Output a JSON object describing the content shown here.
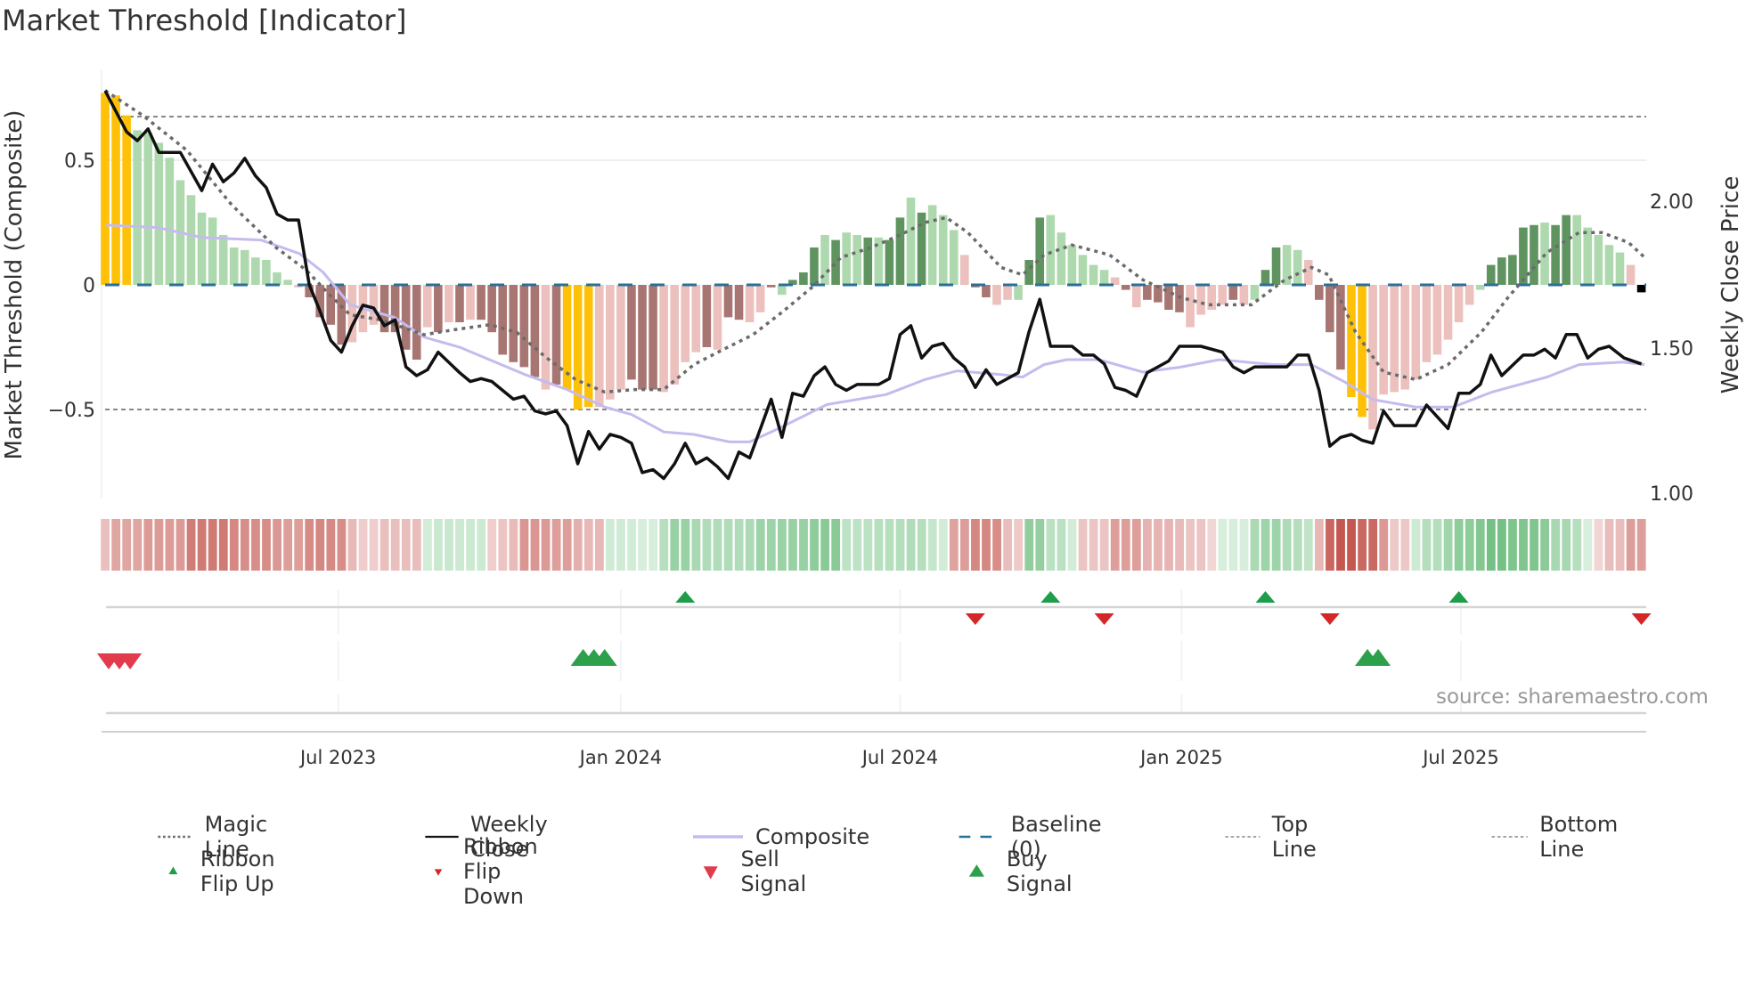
{
  "title": "Market Threshold [Indicator]",
  "source": "source: sharemaestro.com",
  "chart_data": {
    "type": "bar+line",
    "title": "Market Threshold [Indicator]",
    "ylabel_left": "Market Threshold (Composite)",
    "ylabel_right": "Weekly Close Price",
    "ylim_left": [
      -0.85,
      0.85
    ],
    "ylim_right": [
      1.0,
      2.3
    ],
    "left_ticks": [
      {
        "v": 0.5,
        "label": "0.5"
      },
      {
        "v": 0,
        "label": "0"
      },
      {
        "v": -0.5,
        "label": "−0.5"
      }
    ],
    "right_ticks": [
      {
        "v": 2.0,
        "label": "2.00"
      },
      {
        "v": 1.5,
        "label": "1.50"
      },
      {
        "v": 1.0,
        "label": "1.00"
      }
    ],
    "x_unit": "week index (0 = first week, Feb 2023)",
    "x_ticks": [
      {
        "x": 21.7,
        "label": "Jul 2023"
      },
      {
        "x": 48,
        "label": "Jan 2024"
      },
      {
        "x": 74,
        "label": "Jul 2024"
      },
      {
        "x": 100.2,
        "label": "Jan 2025"
      },
      {
        "x": 126.2,
        "label": "Jul 2025"
      }
    ],
    "top_line": 0.675,
    "bottom_line": -0.5,
    "baseline": 0,
    "bar_values": [
      0.77,
      0.76,
      0.68,
      0.62,
      0.61,
      0.57,
      0.51,
      0.42,
      0.36,
      0.29,
      0.27,
      0.2,
      0.15,
      0.14,
      0.11,
      0.1,
      0.05,
      0.02,
      -0.01,
      -0.05,
      -0.13,
      -0.16,
      -0.24,
      -0.23,
      -0.19,
      -0.16,
      -0.19,
      -0.19,
      -0.26,
      -0.3,
      -0.17,
      -0.19,
      -0.15,
      -0.15,
      -0.14,
      -0.14,
      -0.19,
      -0.28,
      -0.31,
      -0.33,
      -0.37,
      -0.42,
      -0.4,
      -0.42,
      -0.5,
      -0.49,
      -0.49,
      -0.46,
      -0.42,
      -0.38,
      -0.42,
      -0.42,
      -0.43,
      -0.4,
      -0.31,
      -0.27,
      -0.25,
      -0.26,
      -0.13,
      -0.14,
      -0.15,
      -0.11,
      -0.01,
      -0.04,
      0.02,
      0.05,
      0.15,
      0.2,
      0.18,
      0.21,
      0.2,
      0.19,
      0.19,
      0.18,
      0.27,
      0.35,
      0.29,
      0.32,
      0.28,
      0.22,
      0.12,
      -0.01,
      -0.05,
      -0.08,
      -0.06,
      -0.06,
      0.1,
      0.27,
      0.28,
      0.21,
      0.16,
      0.12,
      0.08,
      0.06,
      0.03,
      -0.02,
      -0.09,
      -0.06,
      -0.07,
      -0.1,
      -0.11,
      -0.17,
      -0.12,
      -0.1,
      -0.08,
      -0.06,
      -0.08,
      -0.06,
      0.06,
      0.15,
      0.16,
      0.14,
      0.1,
      -0.06,
      -0.19,
      -0.34,
      -0.45,
      -0.53,
      -0.58,
      -0.44,
      -0.43,
      -0.42,
      -0.38,
      -0.31,
      -0.28,
      -0.22,
      -0.15,
      -0.08,
      -0.02,
      0.08,
      0.11,
      0.12,
      0.23,
      0.24,
      0.25,
      0.24,
      0.28,
      0.28,
      0.23,
      0.2,
      0.16,
      0.13,
      0.08,
      -0.03
    ],
    "bar_classes": "YYYgggggggggggggggrRRRRrrrRRRRrRrRrRRRRRRrRYYYrrrRRRrrrrRrRRrrRgGGGgGggGgGGgGgggrRRrrgGGggggggrRrRRRRrrrrRrgGGggrRRRYYrrrrrrrrrrgGGGGGgGGgggggr",
    "bar_class_legend": {
      "Y": "extreme",
      "G": "positive rising",
      "g": "positive easing",
      "R": "negative falling",
      "r": "negative easing"
    },
    "colors": {
      "Y": "#ffc107",
      "G": "#5f9460",
      "g": "#aed9ae",
      "R": "#a87672",
      "r": "#ebc0bd",
      "magic": "#6b6b6b",
      "close": "#111111",
      "composite": "#c5bbee",
      "baseline": "#2a6f97",
      "flip_up": "#1e9e4a",
      "flip_down": "#d62728",
      "sell": "#e23b4b",
      "buy": "#2ca04a"
    },
    "magic_line": [
      [
        0,
        0.78
      ],
      [
        3.5,
        0.68
      ],
      [
        7.6,
        0.54
      ],
      [
        11.8,
        0.32
      ],
      [
        15.9,
        0.15
      ],
      [
        18.7,
        0.06
      ],
      [
        20.9,
        -0.04
      ],
      [
        22.8,
        -0.12
      ],
      [
        25.6,
        -0.14
      ],
      [
        29.7,
        -0.2
      ],
      [
        32.5,
        -0.18
      ],
      [
        35.8,
        -0.16
      ],
      [
        38.3,
        -0.19
      ],
      [
        41,
        -0.29
      ],
      [
        43.8,
        -0.38
      ],
      [
        46.5,
        -0.43
      ],
      [
        49.3,
        -0.42
      ],
      [
        52,
        -0.42
      ],
      [
        54.8,
        -0.32
      ],
      [
        57.5,
        -0.26
      ],
      [
        60.3,
        -0.2
      ],
      [
        63,
        -0.11
      ],
      [
        65.8,
        -0.01
      ],
      [
        68.5,
        0.11
      ],
      [
        71.3,
        0.15
      ],
      [
        74,
        0.2
      ],
      [
        76.3,
        0.25
      ],
      [
        78.3,
        0.27
      ],
      [
        80.3,
        0.21
      ],
      [
        83.4,
        0.07
      ],
      [
        85.4,
        0.04
      ],
      [
        87.4,
        0.12
      ],
      [
        90,
        0.16
      ],
      [
        93.5,
        0.12
      ],
      [
        96.6,
        0.02
      ],
      [
        100.1,
        -0.05
      ],
      [
        102.7,
        -0.08
      ],
      [
        106.7,
        -0.08
      ],
      [
        109.8,
        0.02
      ],
      [
        112.3,
        0.07
      ],
      [
        113.9,
        0.04
      ],
      [
        116.4,
        -0.19
      ],
      [
        119,
        -0.35
      ],
      [
        122,
        -0.38
      ],
      [
        125,
        -0.32
      ],
      [
        128.1,
        -0.19
      ],
      [
        130.6,
        -0.05
      ],
      [
        134.2,
        0.13
      ],
      [
        137.2,
        0.21
      ],
      [
        139.3,
        0.21
      ],
      [
        141.8,
        0.17
      ],
      [
        143.3,
        0.11
      ]
    ],
    "composite_line": [
      [
        0,
        0.24
      ],
      [
        4.9,
        0.23
      ],
      [
        9,
        0.19
      ],
      [
        14.5,
        0.18
      ],
      [
        18.1,
        0.125
      ],
      [
        20.3,
        0.05
      ],
      [
        22.8,
        -0.08
      ],
      [
        26.9,
        -0.13
      ],
      [
        29.7,
        -0.21
      ],
      [
        33,
        -0.25
      ],
      [
        39.1,
        -0.36
      ],
      [
        43,
        -0.42
      ],
      [
        46.5,
        -0.49
      ],
      [
        49,
        -0.52
      ],
      [
        52,
        -0.59
      ],
      [
        54.8,
        -0.6
      ],
      [
        58.1,
        -0.63
      ],
      [
        60,
        -0.63
      ],
      [
        62.5,
        -0.58
      ],
      [
        67.2,
        -0.48
      ],
      [
        72.7,
        -0.44
      ],
      [
        76.3,
        -0.38
      ],
      [
        79.3,
        -0.345
      ],
      [
        83.4,
        -0.36
      ],
      [
        85.4,
        -0.37
      ],
      [
        87.4,
        -0.32
      ],
      [
        89.5,
        -0.3
      ],
      [
        92.5,
        -0.3
      ],
      [
        96.6,
        -0.35
      ],
      [
        100.1,
        -0.33
      ],
      [
        103.7,
        -0.3
      ],
      [
        108.8,
        -0.32
      ],
      [
        112.3,
        -0.32
      ],
      [
        115.4,
        -0.39
      ],
      [
        118,
        -0.46
      ],
      [
        122,
        -0.49
      ],
      [
        125.5,
        -0.49
      ],
      [
        129.1,
        -0.43
      ],
      [
        134.2,
        -0.37
      ],
      [
        137.2,
        -0.32
      ],
      [
        141.3,
        -0.31
      ],
      [
        143.3,
        -0.32
      ]
    ],
    "weekly_close": [
      [
        0,
        2.37
      ],
      [
        2,
        2.23
      ],
      [
        3,
        2.2
      ],
      [
        4,
        2.24
      ],
      [
        5,
        2.16
      ],
      [
        7,
        2.16
      ],
      [
        9,
        2.03
      ],
      [
        10,
        2.12
      ],
      [
        11,
        2.06
      ],
      [
        12,
        2.09
      ],
      [
        13,
        2.14
      ],
      [
        14,
        2.08
      ],
      [
        15,
        2.04
      ],
      [
        16,
        1.95
      ],
      [
        17,
        1.93
      ],
      [
        18,
        1.93
      ],
      [
        19,
        1.71
      ],
      [
        20,
        1.62
      ],
      [
        21,
        1.52
      ],
      [
        22,
        1.48
      ],
      [
        23,
        1.57
      ],
      [
        24,
        1.64
      ],
      [
        25,
        1.63
      ],
      [
        26,
        1.57
      ],
      [
        27,
        1.59
      ],
      [
        28,
        1.43
      ],
      [
        29,
        1.4
      ],
      [
        30,
        1.42
      ],
      [
        31,
        1.48
      ],
      [
        33,
        1.41
      ],
      [
        34,
        1.38
      ],
      [
        35,
        1.39
      ],
      [
        36,
        1.38
      ],
      [
        37,
        1.35
      ],
      [
        38,
        1.32
      ],
      [
        39,
        1.33
      ],
      [
        40,
        1.28
      ],
      [
        41,
        1.27
      ],
      [
        42,
        1.28
      ],
      [
        43,
        1.23
      ],
      [
        44,
        1.1
      ],
      [
        45,
        1.21
      ],
      [
        46,
        1.15
      ],
      [
        47,
        1.2
      ],
      [
        48,
        1.19
      ],
      [
        49,
        1.17
      ],
      [
        50,
        1.07
      ],
      [
        51,
        1.08
      ],
      [
        52,
        1.05
      ],
      [
        53,
        1.1
      ],
      [
        54,
        1.17
      ],
      [
        55,
        1.1
      ],
      [
        56,
        1.12
      ],
      [
        57,
        1.09
      ],
      [
        58,
        1.05
      ],
      [
        59,
        1.14
      ],
      [
        60,
        1.12
      ],
      [
        61,
        1.22
      ],
      [
        62,
        1.32
      ],
      [
        63,
        1.19
      ],
      [
        64,
        1.34
      ],
      [
        65,
        1.33
      ],
      [
        66,
        1.4
      ],
      [
        67,
        1.43
      ],
      [
        68,
        1.37
      ],
      [
        69,
        1.35
      ],
      [
        70,
        1.37
      ],
      [
        72,
        1.37
      ],
      [
        73,
        1.39
      ],
      [
        74,
        1.54
      ],
      [
        75,
        1.57
      ],
      [
        76,
        1.46
      ],
      [
        77,
        1.5
      ],
      [
        78,
        1.51
      ],
      [
        79,
        1.46
      ],
      [
        80,
        1.43
      ],
      [
        81,
        1.36
      ],
      [
        82,
        1.42
      ],
      [
        83,
        1.37
      ],
      [
        85,
        1.41
      ],
      [
        86,
        1.55
      ],
      [
        87,
        1.66
      ],
      [
        88,
        1.5
      ],
      [
        90,
        1.5
      ],
      [
        91,
        1.47
      ],
      [
        92,
        1.47
      ],
      [
        93,
        1.44
      ],
      [
        94,
        1.36
      ],
      [
        95,
        1.35
      ],
      [
        96,
        1.33
      ],
      [
        97,
        1.41
      ],
      [
        98,
        1.43
      ],
      [
        99,
        1.45
      ],
      [
        100,
        1.5
      ],
      [
        102,
        1.5
      ],
      [
        104,
        1.48
      ],
      [
        105,
        1.43
      ],
      [
        106,
        1.41
      ],
      [
        107,
        1.43
      ],
      [
        110,
        1.43
      ],
      [
        111,
        1.47
      ],
      [
        112,
        1.47
      ],
      [
        113,
        1.35
      ],
      [
        114,
        1.16
      ],
      [
        115,
        1.19
      ],
      [
        116,
        1.2
      ],
      [
        117,
        1.18
      ],
      [
        118,
        1.17
      ],
      [
        119,
        1.28
      ],
      [
        120,
        1.23
      ],
      [
        122,
        1.23
      ],
      [
        123,
        1.3
      ],
      [
        124,
        1.26
      ],
      [
        125,
        1.22
      ],
      [
        126,
        1.34
      ],
      [
        127,
        1.34
      ],
      [
        128,
        1.37
      ],
      [
        129,
        1.47
      ],
      [
        130,
        1.4
      ],
      [
        132,
        1.47
      ],
      [
        133,
        1.47
      ],
      [
        134,
        1.49
      ],
      [
        135,
        1.46
      ],
      [
        136,
        1.54
      ],
      [
        137,
        1.54
      ],
      [
        138,
        1.46
      ],
      [
        139,
        1.49
      ],
      [
        140,
        1.5
      ],
      [
        141.4,
        1.46
      ],
      [
        143,
        1.44
      ]
    ],
    "ribbon_flip_up": [
      54,
      88,
      108,
      126
    ],
    "ribbon_flip_down": [
      81,
      93,
      114,
      143
    ],
    "sell_signals": [
      0,
      1,
      2
    ],
    "buy_signals": [
      44,
      45,
      46,
      117,
      118
    ],
    "legend_placement": "bottom",
    "legend": [
      {
        "label": "Magic Line",
        "symbol": "dotted-line"
      },
      {
        "label": "Weekly Close",
        "symbol": "solid-black"
      },
      {
        "label": "Composite",
        "symbol": "solid-lavender"
      },
      {
        "label": "Baseline (0)",
        "symbol": "dashed-blue"
      },
      {
        "label": "Top Line",
        "symbol": "dashed-gray"
      },
      {
        "label": "Bottom Line",
        "symbol": "dashed-gray"
      },
      {
        "label": "Ribbon Flip Up",
        "symbol": "tri-up-small"
      },
      {
        "label": "Ribbon Flip Down",
        "symbol": "tri-down-small"
      },
      {
        "label": "Sell Signal",
        "symbol": "tri-down-big"
      },
      {
        "label": "Buy Signal",
        "symbol": "tri-up-big"
      }
    ]
  }
}
